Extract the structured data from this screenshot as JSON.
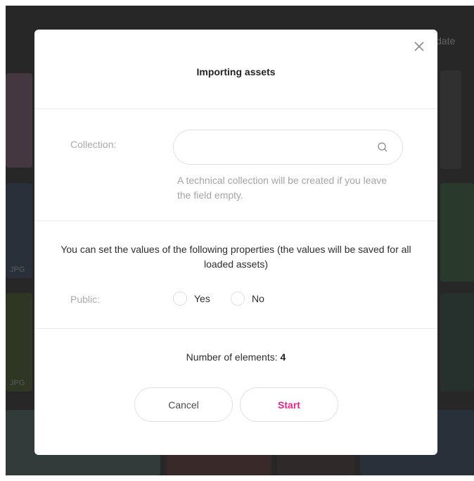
{
  "background": {
    "header_fragment": "date",
    "tile_badges": [
      "JPG",
      "JPG"
    ]
  },
  "dialog": {
    "title": "Importing assets",
    "close_icon": "close-icon",
    "collection": {
      "label": "Collection:",
      "value": "",
      "placeholder": "",
      "search_icon": "search-icon",
      "hint": "A technical collection will be created if you leave the field empty."
    },
    "properties": {
      "description": "You can set the values of the following properties (the values will be saved for all loaded assets)",
      "public_label": "Public:",
      "options": [
        "Yes",
        "No"
      ],
      "selected": null
    },
    "count": {
      "label": "Number of elements:",
      "value": "4"
    },
    "buttons": {
      "cancel": "Cancel",
      "start": "Start"
    },
    "colors": {
      "accent": "#e0288a",
      "overlay": "#3c3c3c"
    }
  }
}
